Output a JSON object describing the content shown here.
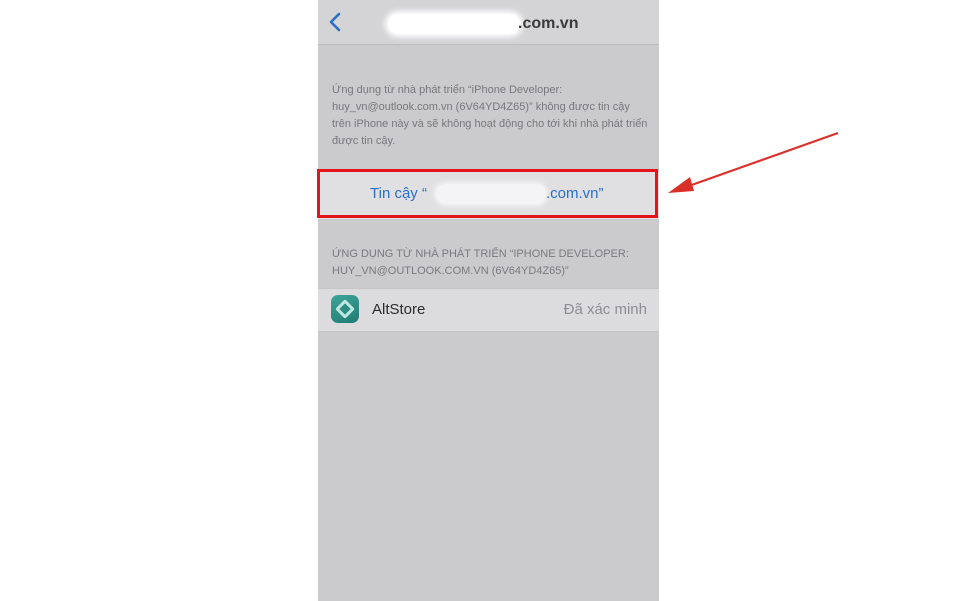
{
  "nav": {
    "back_icon": "chevron-left-icon",
    "title": ".com.vn"
  },
  "info": {
    "text": "Ứng dụng từ nhà phát triển “iPhone Developer: huy_vn@outlook.com.vn (6V64YD4Z65)” không được tin cậy trên iPhone này và sẽ không hoạt động cho tới khi nhà phát triển được tin cậy."
  },
  "trust_button": {
    "prefix": "Tin cậy “",
    "suffix": ".com.vn”"
  },
  "section": {
    "header": "ỨNG DỤNG TỪ NHÀ PHÁT TRIỂN “IPHONE DEVELOPER: HUY_VN@OUTLOOK.COM.VN (6V64YD4Z65)”"
  },
  "apps": [
    {
      "name": "AltStore",
      "status": "Đã xác minh",
      "icon": "altstore-app-icon"
    }
  ],
  "annotation": {
    "highlight_color": "#e3151b",
    "arrow_icon": "red-arrow-pointer-icon"
  },
  "colors": {
    "link_blue": "#2a6fc4",
    "background_gray": "#cbcbcd"
  }
}
